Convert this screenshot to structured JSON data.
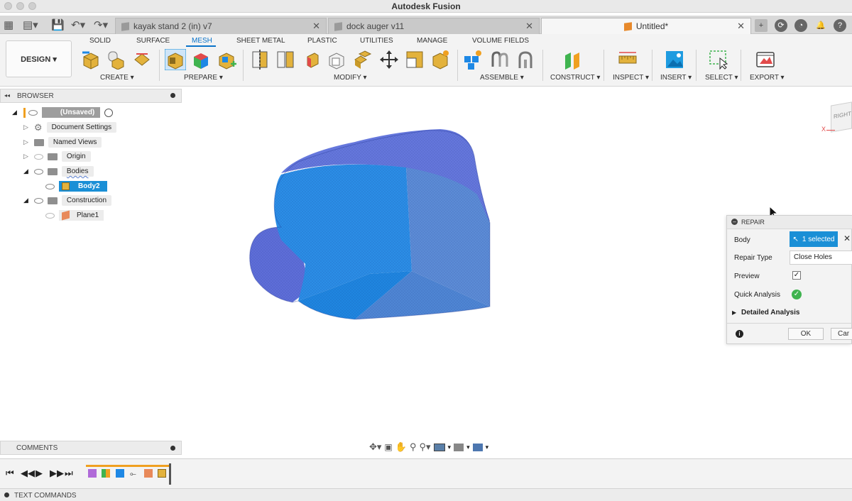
{
  "app": {
    "title": "Autodesk Fusion"
  },
  "doc_tabs": [
    {
      "label": "kayak stand 2 (in) v7",
      "active": false
    },
    {
      "label": "dock auger v11",
      "active": false
    },
    {
      "label": "Untitled*",
      "active": true
    }
  ],
  "workspace": {
    "label": "DESIGN ▾"
  },
  "ribbon_tabs": [
    {
      "label": "SOLID"
    },
    {
      "label": "SURFACE"
    },
    {
      "label": "MESH",
      "active": true
    },
    {
      "label": "SHEET METAL"
    },
    {
      "label": "PLASTIC"
    },
    {
      "label": "UTILITIES"
    },
    {
      "label": "MANAGE"
    },
    {
      "label": "VOLUME FIELDS"
    }
  ],
  "ribbon_groups": [
    {
      "label": "CREATE ▾"
    },
    {
      "label": "PREPARE ▾"
    },
    {
      "label": "MODIFY ▾"
    },
    {
      "label": "ASSEMBLE ▾"
    },
    {
      "label": "CONSTRUCT ▾"
    },
    {
      "label": "INSPECT ▾"
    },
    {
      "label": "INSERT ▾"
    },
    {
      "label": "SELECT ▾"
    },
    {
      "label": "EXPORT ▾"
    }
  ],
  "browser": {
    "header": "BROWSER",
    "items": [
      {
        "label": "(Unsaved)"
      },
      {
        "label": "Document Settings"
      },
      {
        "label": "Named Views"
      },
      {
        "label": "Origin"
      },
      {
        "label": "Bodies"
      },
      {
        "label": "Body2"
      },
      {
        "label": "Construction"
      },
      {
        "label": "Plane1"
      }
    ]
  },
  "viewcube": {
    "face": "RIGHT",
    "axis": "X"
  },
  "repair": {
    "title": "REPAIR",
    "body_label": "Body",
    "body_value": "1 selected",
    "repair_type_label": "Repair Type",
    "repair_type_value": "Close Holes",
    "preview_label": "Preview",
    "preview_checked": true,
    "quick_analysis_label": "Quick Analysis",
    "detailed_analysis_label": "Detailed Analysis",
    "ok_label": "OK",
    "cancel_label": "Car"
  },
  "comments": {
    "label": "COMMENTS"
  },
  "text_commands": {
    "label": "TEXT COMMANDS"
  },
  "colors": {
    "accent": "#0a73c9",
    "selection": "#1a8fd6",
    "mesh_light": "#2b8ee6",
    "mesh_dark": "#5e6ed8"
  }
}
